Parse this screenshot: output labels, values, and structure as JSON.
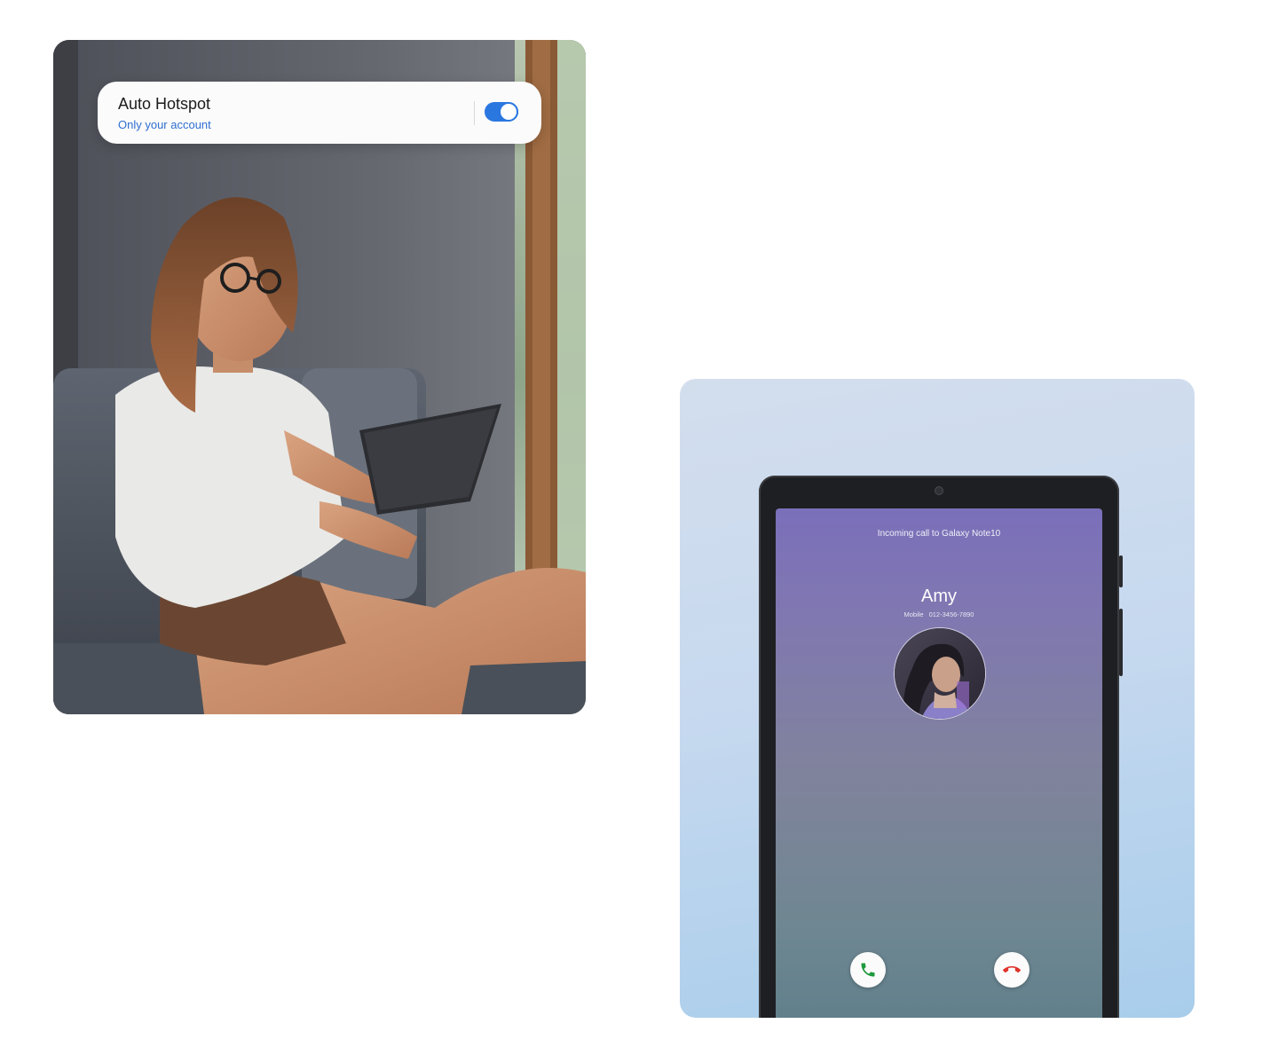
{
  "hotspot_card": {
    "title": "Auto Hotspot",
    "subtitle": "Only your account",
    "toggle_on": true,
    "accent_color": "#2b77e0"
  },
  "incoming_call": {
    "header": "Incoming call to Galaxy Note10",
    "caller_name": "Amy",
    "number_type": "Mobile",
    "number": "012-3456-7890",
    "accept_icon": "phone-accept-icon",
    "decline_icon": "phone-decline-icon",
    "accept_color": "#1f9a3e",
    "decline_color": "#e0342c"
  }
}
